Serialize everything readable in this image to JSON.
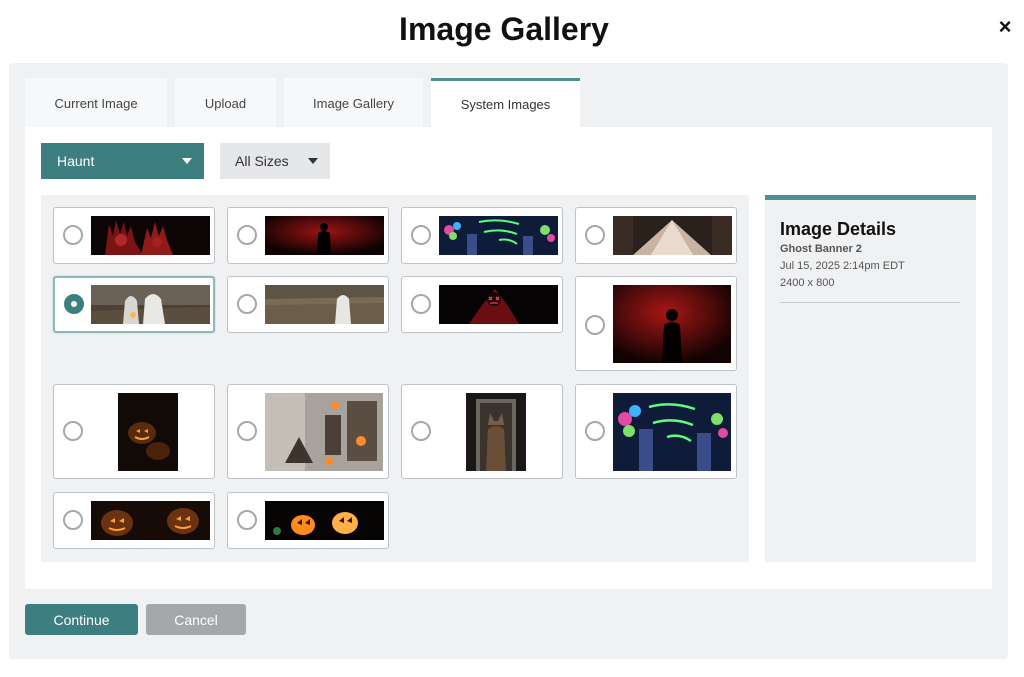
{
  "modal": {
    "title": "Image Gallery",
    "close_label": "×"
  },
  "tabs": [
    {
      "label": "Current Image"
    },
    {
      "label": "Upload"
    },
    {
      "label": "Image Gallery"
    },
    {
      "label": "System Images",
      "active": true
    }
  ],
  "filters": {
    "category": "Haunt",
    "size": "All Sizes"
  },
  "images": [
    {
      "name": "bloody-hands",
      "icon": "bloody-hands-thumbnail"
    },
    {
      "name": "red-smoke-silhouette-wide",
      "icon": "red-smoke-figure-thumbnail"
    },
    {
      "name": "come-play-neon-wide",
      "icon": "neon-graffiti-thumbnail"
    },
    {
      "name": "tunnel-light",
      "icon": "tunnel-light-thumbnail"
    },
    {
      "name": "ghost-banner-2",
      "icon": "ghost-lantern-thumbnail",
      "selected": true
    },
    {
      "name": "ghost-field",
      "icon": "ghost-field-thumbnail"
    },
    {
      "name": "neon-mask",
      "icon": "neon-mask-thumbnail"
    },
    {
      "name": "red-smoke-silhouette",
      "icon": "red-smoke-figure-thumbnail"
    },
    {
      "name": "pumpkins-dark",
      "icon": "jack-o-lantern-thumbnail"
    },
    {
      "name": "haunted-scene",
      "icon": "haunted-scene-thumbnail"
    },
    {
      "name": "werewolf-door",
      "icon": "werewolf-thumbnail"
    },
    {
      "name": "come-play-neon",
      "icon": "neon-graffiti-thumbnail"
    },
    {
      "name": "pumpkins-banner",
      "icon": "jack-o-lantern-thumbnail"
    },
    {
      "name": "jack-o-lanterns-banner",
      "icon": "jack-o-lantern-thumbnail"
    }
  ],
  "details": {
    "title": "Image Details",
    "name": "Ghost Banner 2",
    "date": "Jul 15, 2025 2:14pm EDT",
    "dimensions": "2400 x 800"
  },
  "actions": {
    "continue_label": "Continue",
    "cancel_label": "Cancel"
  },
  "colors": {
    "accent": "#3d7f80",
    "accent_light": "#4e8f90",
    "cancel": "#a5a8aa",
    "panel_bg": "#f0f1f3"
  }
}
